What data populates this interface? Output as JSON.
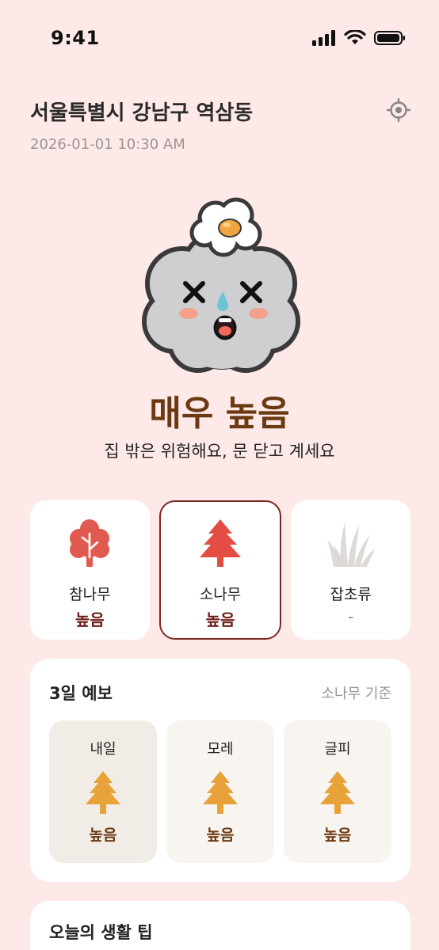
{
  "status_bar": {
    "time": "9:41"
  },
  "header": {
    "location": "서울특별시 강남구 역삼동",
    "datetime": "2026-01-01 10:30 AM"
  },
  "hero": {
    "level": "매우 높음",
    "advice": "집 밖은 위험해요, 문 닫고 계세요"
  },
  "species": [
    {
      "name": "참나무",
      "level": "높음",
      "icon": "oak-tree-icon",
      "selected": false
    },
    {
      "name": "소나무",
      "level": "높음",
      "icon": "pine-tree-icon",
      "selected": true
    },
    {
      "name": "잡초류",
      "level": "-",
      "icon": "grass-icon",
      "selected": false
    }
  ],
  "forecast": {
    "title": "3일 예보",
    "basis": "소나무 기준",
    "days": [
      {
        "name": "내일",
        "level": "높음"
      },
      {
        "name": "모레",
        "level": "높음"
      },
      {
        "name": "글피",
        "level": "높음"
      }
    ]
  },
  "tips": {
    "title": "오늘의 생활 팁"
  },
  "colors": {
    "background": "#fde9e8",
    "level_text": "#6b3a13",
    "selected_border": "#7a2a24",
    "oak_red": "#e05a50",
    "pine_red": "#e34d44",
    "forecast_pine": "#e8a23a"
  }
}
